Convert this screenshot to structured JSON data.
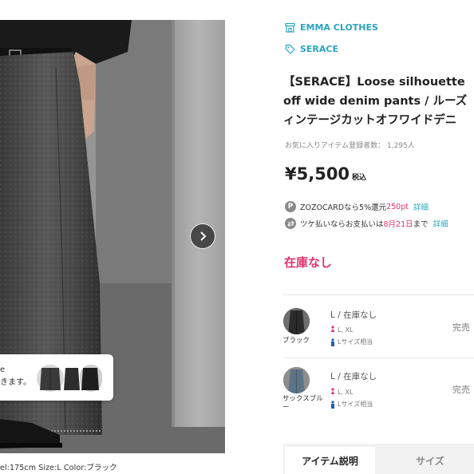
{
  "image_area": {
    "popup_text_line1": "e",
    "popup_text_line2": "きます。",
    "caption": "el:175cm Size:L Color:ブラック"
  },
  "brand": {
    "label": "EMMA CLOTHES",
    "icon": "shop-icon"
  },
  "shop_tag": {
    "label": "SERACE",
    "icon": "tag-icon"
  },
  "product": {
    "title_line1": "【SERACE】Loose silhouette",
    "title_line2": "off wide denim pants / ルーズ",
    "title_line3": "ィンテージカットオフワイドデニ",
    "favorites_label": "お気に入りアイテム登録者数：",
    "favorites_count": "1,295人",
    "price": "¥5,500",
    "tax_label": "税込"
  },
  "benefits": {
    "zozocard_prefix": "ZOZOCARDなら5%還元",
    "zozocard_points": "250pt",
    "zozocard_link": "詳細",
    "tsuke_prefix": "ツケ払いならお支払いは",
    "tsuke_date": "8月21日",
    "tsuke_suffix": "まで",
    "tsuke_link": "詳細"
  },
  "stock_status": "在庫なし",
  "variants": [
    {
      "color": "ブラック",
      "size_status": "L / 在庫なし",
      "size_detail": "L, XL",
      "size_note": "Lサイズ相当",
      "button": "完売"
    },
    {
      "color": "サックスブル",
      "color_cont": "ー",
      "size_status": "L / 在庫なし",
      "size_detail": "L, XL",
      "size_note": "Lサイズ相当",
      "button": "完売"
    }
  ],
  "tabs": {
    "description": "アイテム説明",
    "size": "サイズ"
  },
  "colors": {
    "accent": "#2aa5c0",
    "sale_pink": "#e0336e"
  }
}
